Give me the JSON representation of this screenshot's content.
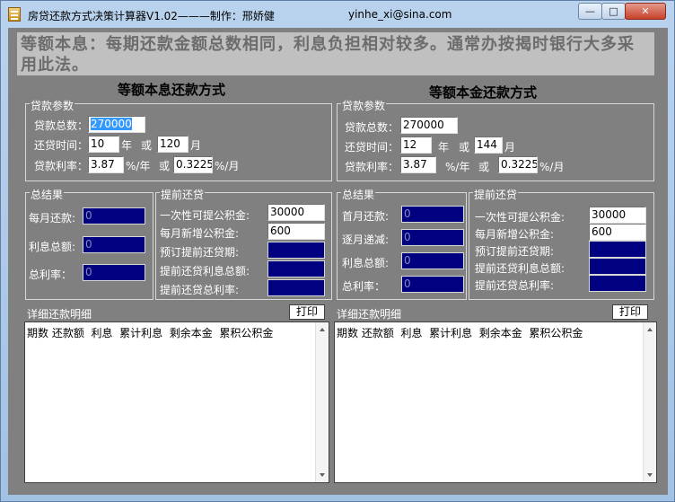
{
  "window": {
    "title": "房贷还款方式决策计算器V1.02———制作：邢娇健",
    "email": "yinhe_xi@sina.com",
    "minimize": "—",
    "maximize": "□",
    "close": "✕"
  },
  "banner": "等额本息：每期还款金额总数相同，利息负担相对较多。通常办按揭时银行大多采用此法。",
  "left": {
    "title": "等额本息还款方式",
    "params": {
      "legend": "贷款参数",
      "amount_label": "贷款总数：",
      "amount": "270000",
      "term_label": "还贷时间：",
      "years": "10",
      "year_unit": "年",
      "or": "或",
      "months": "120",
      "month_unit": "月",
      "rate_label": "贷款利率：",
      "rate_year": "3.87",
      "rate_year_unit": "%/年",
      "rate_month": "0.3225",
      "rate_month_unit": "%/月"
    },
    "result": {
      "legend": "总结果",
      "monthly_label": "每月还款:",
      "monthly": "0",
      "interest_label": "利息总额:",
      "interest": "0",
      "rate_label": "总利率：",
      "rate": "0"
    },
    "prepay": {
      "legend": "提前还贷",
      "fund_label": "一次性可提公积金:",
      "fund": "30000",
      "monthly_add_label": "每月新增公积金:",
      "monthly_add": "600",
      "period_label": "预订提前还贷期:",
      "interest_label": "提前还贷利息总额:",
      "rate_label": "提前还贷总利率:"
    },
    "detail": {
      "label": "详细还款明细",
      "print": "打印",
      "header": "期数 还款额  利息  累计利息  剩余本金  累积公积金"
    }
  },
  "right": {
    "title": "等额本金还款方式",
    "params": {
      "legend": "贷款参数",
      "amount_label": "贷款总数：",
      "amount": "270000",
      "term_label": "还贷时间：",
      "years": "12",
      "year_unit": "年",
      "or": "或",
      "months": "144",
      "month_unit": "月",
      "rate_label": "贷款利率：",
      "rate_year": "3.87",
      "rate_year_unit": "%/年",
      "rate_month": "0.3225",
      "rate_month_unit": "%/月"
    },
    "result": {
      "legend": "总结果",
      "first_label": "首月还款:",
      "first": "0",
      "decrease_label": "逐月递减:",
      "decrease": "0",
      "interest_label": "利息总额:",
      "interest": "0",
      "rate_label": "总利率：",
      "rate": "0"
    },
    "prepay": {
      "legend": "提前还贷",
      "fund_label": "一次性可提公积金:",
      "fund": "30000",
      "monthly_add_label": "每月新增公积金:",
      "monthly_add": "600",
      "period_label": "预订提前还贷期:",
      "interest_label": "提前还贷利息总额:",
      "rate_label": "提前还贷总利率:"
    },
    "detail": {
      "label": "详细还款明细",
      "print": "打印",
      "header": "期数 还款额  利息  累计利息  剩余本金  累积公积金"
    }
  }
}
